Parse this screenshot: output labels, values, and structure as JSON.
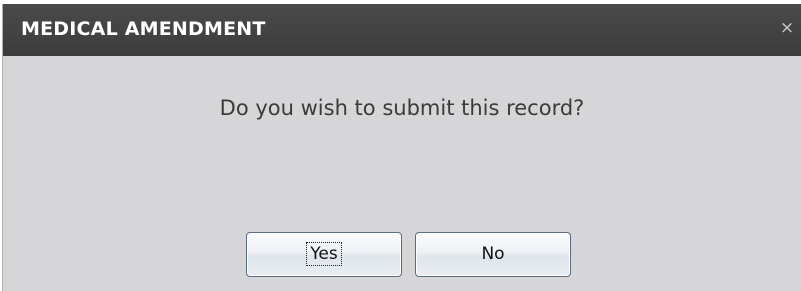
{
  "dialog": {
    "title": "MEDICAL AMENDMENT",
    "close_icon": "close-icon",
    "close_glyph": "×",
    "message": "Do you wish to submit this record?",
    "buttons": {
      "yes_label": "Yes",
      "no_label": "No"
    },
    "colors": {
      "titlebar": "#414142",
      "body": "#d6d6d8",
      "title_text": "#ffffff",
      "message_text": "#3b3b3b"
    }
  }
}
